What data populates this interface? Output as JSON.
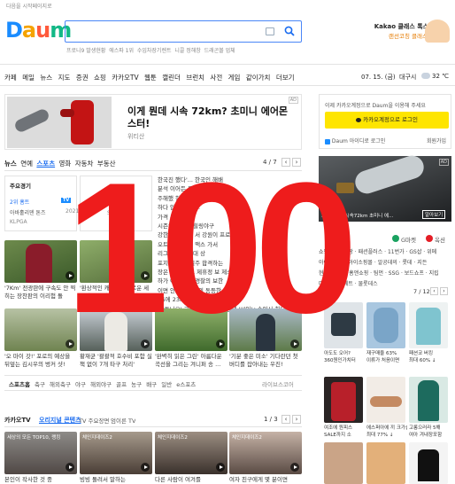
{
  "top_link": "다음을 시작페이지로",
  "logo": "Daum",
  "search": {
    "placeholder": "",
    "suggest": [
      "프로니9 발생현황",
      "에스파 1위",
      "수입차장기렌트",
      "니콜 정해창",
      "드래곤볼 업체"
    ]
  },
  "banner": {
    "line1": "Kakao 클래스 톡스토어",
    "line2": "랜선코칭 클래스 오픈"
  },
  "nav": [
    "카페",
    "메일",
    "뉴스",
    "지도",
    "증권",
    "쇼핑",
    "카카오TV",
    "웹툰",
    "캘린더",
    "브런치",
    "사전",
    "게임",
    "같이가치",
    "더보기"
  ],
  "date": "07. 15. (금)",
  "weather": {
    "city": "대구시",
    "temp": "32 ℃"
  },
  "ad": {
    "title": "이게 뭔데 시속 72km? 초미니 에어몬스터!",
    "sub": "위티산",
    "tag": "AD"
  },
  "login": {
    "notice": "이제 카카오계정으로 Daum을 이용해 주세요",
    "button": "카카오계정으로 로그인",
    "id_login": "Daum 아이디로 로그인",
    "join": "회원가입"
  },
  "news_tabs": [
    "뉴스",
    "연예",
    "스포츠",
    "영화",
    "자동차",
    "부동산"
  ],
  "news_page": "4 / 7",
  "sports": {
    "box_title": "주요경기",
    "r1a": "2위 홈트",
    "r1b": "아바홀리덴 톤즈",
    "r1c": "2021",
    "r1d": "KLPGA",
    "r2": "TV",
    "r3": "SSG 랜드"
  },
  "headline_frag": [
    "손흥민",
    "작가가",
    "'꼬리'",
    "'홈런존'",
    "가수",
    "비롯한",
    "데",
    "데 현장",
    "1위,거칠었던",
    "1위 토트넘",
    "리,"
  ],
  "headline_visible": [
    "한국진 했다'... 한국인 해배",
    "분석 이어든 모소 누가",
    "주해했 현장 감독 바",
    "하다 입지 아니다.",
    "가격 무직하다.",
    "시즌의 위치인 힐링야구",
    "강한 사정 짓고 서 강원이 프로",
    "오트 전 고문에 맥스 가서",
    "리그 유럽 개막대 상",
    "포지 원 부상 일주 합격하는",
    "장은 중 최 피도 제휴정 보 제소 참",
    "하가 이면 인생 경찰의 보한",
    "이면 안보국 정전의 동등한 리그",
    "LG에 23km 충분으로 한 1번...",
    "'안토니오' 국제 팬들 부름에 콘테 '씨익'+손인사 화답[아(동]"
  ],
  "news_ad": "AD",
  "grid1": [
    {
      "cap": "'7Km' 전광판에 구속도 안 찍히는 장찬판의 이리험 돌"
    },
    {
      "cap": "'환상적인 캐치!' 날카로운 세 콘성으로 완벽한 배터 기"
    },
    {
      "cap": ""
    },
    {
      "cap": ""
    }
  ],
  "grid2": [
    {
      "cap": "'오 마이 갓!' 포로의 예상을 뒤엎는 김시우의 벙커 샷!"
    },
    {
      "cap": "황재균 '괄괄적 호수비 포함 실책 없이 7개 타구 처리'"
    },
    {
      "cap": "'완벽히 읽은 그린' 아름다운 곡선을 그리는 겨니퍼 송 ..."
    },
    {
      "cap": "'기분 좋은 미소' 기다란던 첫 버디를 잡아내는 우진!"
    }
  ],
  "sports_links": [
    "스포츠홈",
    "축구",
    "해외축구",
    "야구",
    "해외야구",
    "골프",
    "농구",
    "배구",
    "일반",
    "e스포츠",
    "라이브스코어"
  ],
  "kakaotv": {
    "label": "카카오TV",
    "tabs": [
      "오리지널 콘텐츠",
      "TV 주요장면",
      "엄이른 TV"
    ],
    "page": "1 / 3"
  },
  "tv_thumbs": [
    {
      "tag": "세상의 모든 TOP10, 랭킹",
      "cap": "본인이 작사한 것 중"
    },
    {
      "tag": "체인지데이즈2",
      "cap": "빙빙 돌려서 말하는"
    },
    {
      "tag": "체인지데이즈2",
      "cap": "다른 사람이 여겨를"
    },
    {
      "tag": "체인지데이즈2",
      "cap": "여자 친구에게 몇 분이면"
    }
  ],
  "right_ad": {
    "text": "초파 가능? 시속72km 초미니 에...",
    "button": "알아보기",
    "tag": "AD"
  },
  "shopping": {
    "tabs": [
      "G마켓",
      "옥션"
    ],
    "links": [
      "쇼핑틀린",
      "쿠팡",
      "패션플러스",
      "11번가",
      "GS샵",
      "위메",
      "아이리스마",
      "아이소핑몰",
      "알공데의",
      "롯데",
      "지든",
      "현대Hmall",
      "홈앤쇼핑",
      "팀먼",
      "SSG",
      "보드쇼프",
      "지립",
      "마니",
      "벨리메트",
      "물롯데스"
    ],
    "page": "7 / 12"
  },
  "products": [
    {
      "cap": "아도도 오어?",
      "price": "360원인가치터"
    },
    {
      "cap": "재구매율 63%",
      "price": "이류가 처음이면"
    },
    {
      "cap": "패션코 버킹",
      "price": "최대 60% ↓"
    },
    {
      "cap": "여조에 원피스",
      "price": "SALE까지 소"
    },
    {
      "cap": "에스퍼아에 끼 크가슬림",
      "price": "최대 77% ↓"
    },
    {
      "cap": "고롱으러라 5해",
      "price": "여아 겨내장포함"
    }
  ],
  "overlay": "100"
}
